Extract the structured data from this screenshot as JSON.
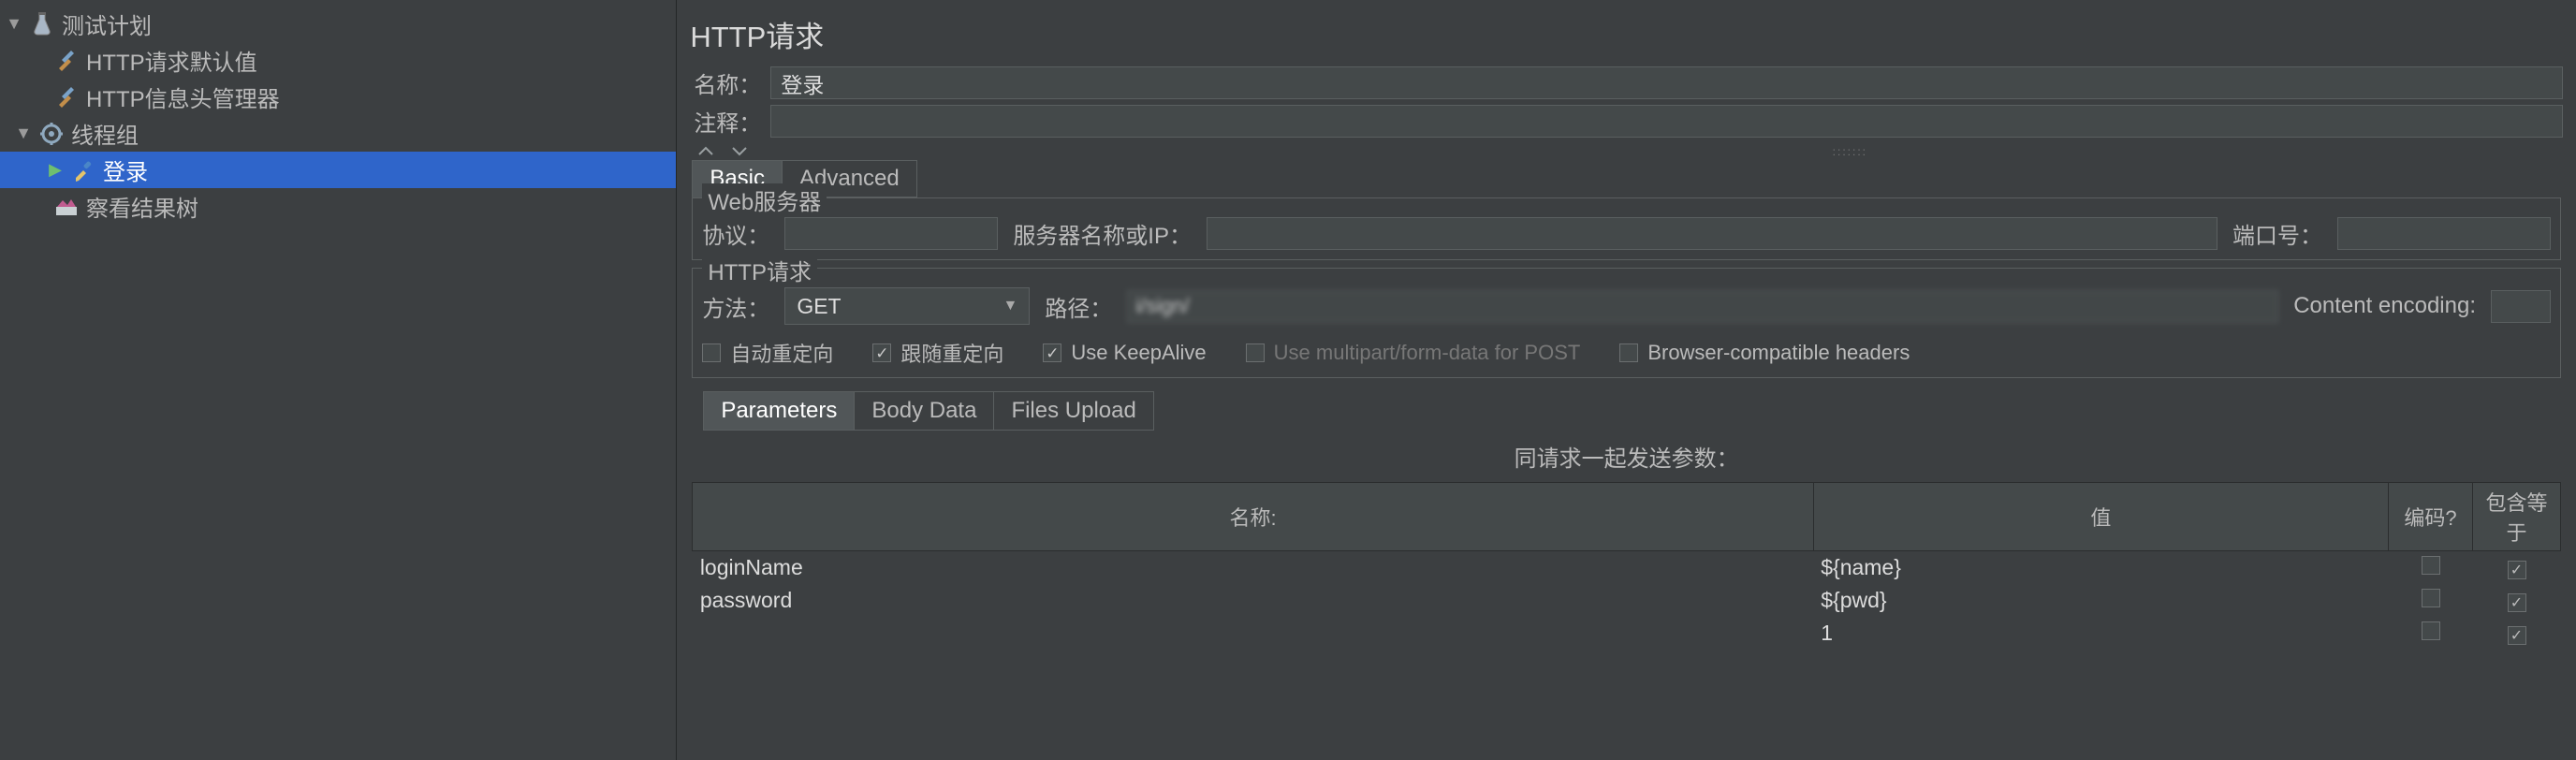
{
  "tree": {
    "root": "测试计划",
    "items": [
      {
        "label": "HTTP请求默认值"
      },
      {
        "label": "HTTP信息头管理器"
      }
    ],
    "threadGroup": "线程组",
    "selected": "登录",
    "resultTree": "察看结果树"
  },
  "panel": {
    "title": "HTTP请求",
    "nameLabel": "名称：",
    "nameValue": "登录",
    "commentLabel": "注释：",
    "commentValue": ""
  },
  "tabs": {
    "basic": "Basic",
    "advanced": "Advanced"
  },
  "webServer": {
    "legend": "Web服务器",
    "protoLabel": "协议：",
    "proto": "",
    "hostLabel": "服务器名称或IP：",
    "host": "",
    "portLabel": "端口号：",
    "port": ""
  },
  "httpReq": {
    "legend": "HTTP请求",
    "methodLabel": "方法：",
    "method": "GET",
    "pathLabel": "路径：",
    "path": "i/sign/",
    "ceLabel": "Content encoding:",
    "ce": ""
  },
  "opts": {
    "autoRedirect": {
      "label": "自动重定向",
      "checked": false
    },
    "followRedirect": {
      "label": "跟随重定向",
      "checked": true
    },
    "keepAlive": {
      "label": "Use KeepAlive",
      "checked": true
    },
    "multipart": {
      "label": "Use multipart/form-data for POST",
      "checked": false,
      "dim": true
    },
    "browserHeaders": {
      "label": "Browser-compatible headers",
      "checked": false
    }
  },
  "subTabs": {
    "params": "Parameters",
    "body": "Body Data",
    "files": "Files Upload"
  },
  "paramsTitle": "同请求一起发送参数：",
  "paramCols": {
    "name": "名称:",
    "value": "值",
    "encode": "编码?",
    "include": "包含等于"
  },
  "paramRows": [
    {
      "name": "loginName",
      "value": "${name}",
      "encode": false,
      "include": true
    },
    {
      "name": "password",
      "value": "${pwd}",
      "encode": false,
      "include": true
    },
    {
      "name": "",
      "value": "1",
      "encode": false,
      "include": true,
      "blurName": true
    }
  ],
  "chart_data": null
}
